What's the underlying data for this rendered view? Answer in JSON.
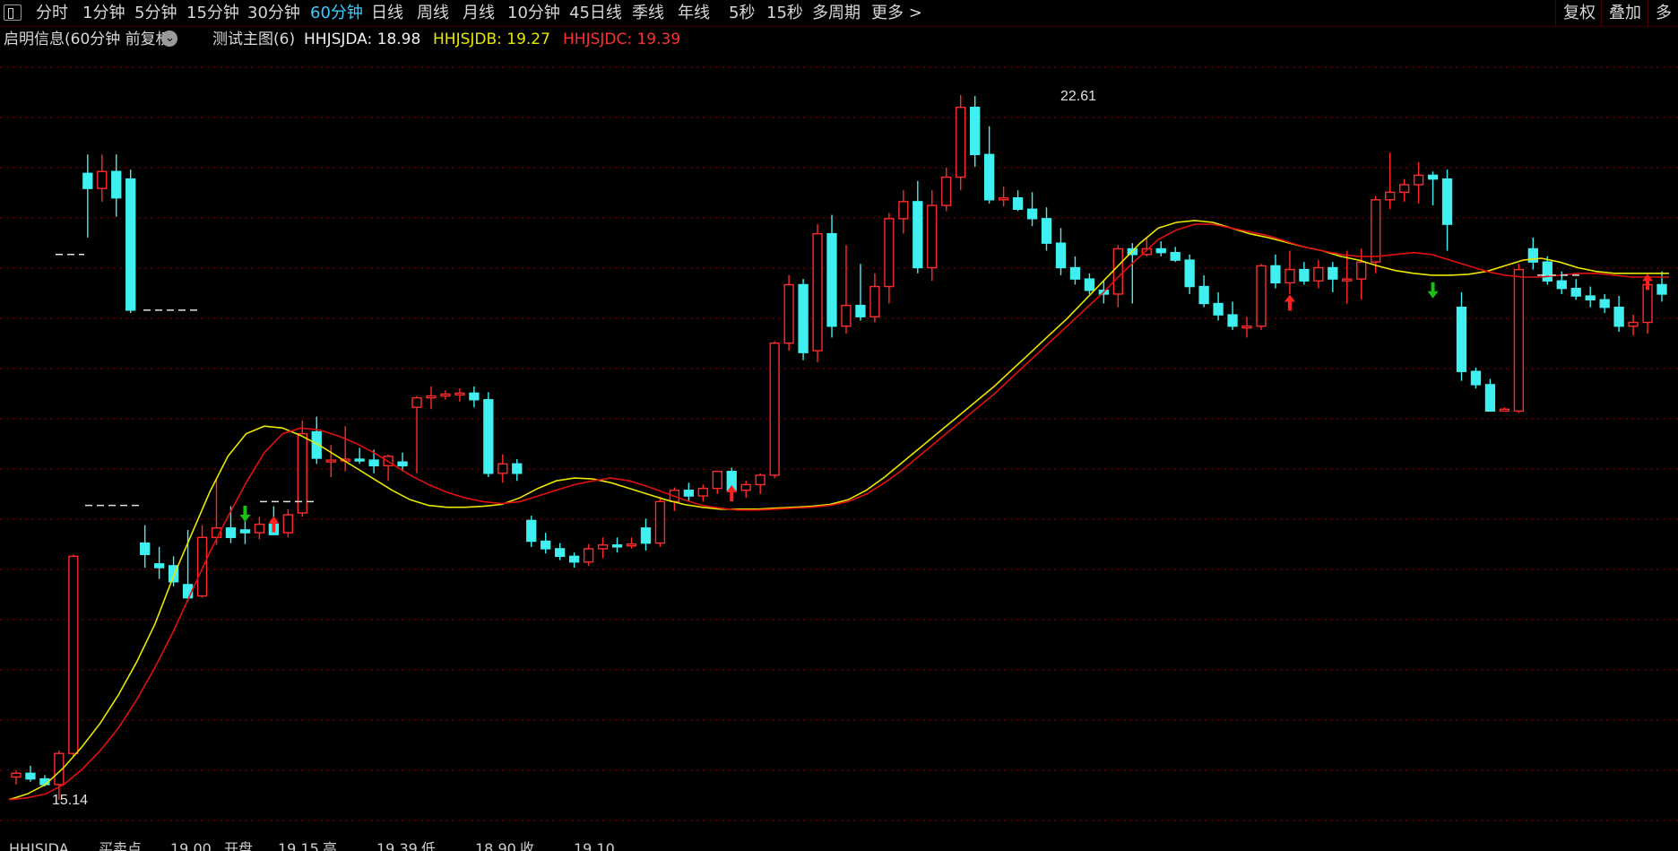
{
  "toolbar": {
    "periods": [
      "分时",
      "1分钟",
      "5分钟",
      "15分钟",
      "30分钟",
      "60分钟",
      "日线",
      "周线",
      "月线",
      "10分钟",
      "45日线",
      "季线",
      "年线",
      "5秒",
      "15秒",
      "多周期",
      "更多 >"
    ],
    "active_index": 5,
    "right": [
      "复权",
      "叠加",
      "多"
    ]
  },
  "info": {
    "title": "启明信息(60分钟 前复权)",
    "indicator": "测试主图(6)",
    "a_label": "HHJSJDA: 18.98",
    "b_label": "HHJSJDB: 19.27",
    "c_label": "HHJSJDC: 19.39"
  },
  "colors": {
    "up": "#ff2b2b",
    "down": "#40f0f0",
    "ma_yellow": "#e8e800",
    "ma_red": "#e01010",
    "grid": "#6a0000",
    "buy_arrow": "#ff2020",
    "sell_arrow": "#18c018"
  },
  "chart": {
    "high_label": "22.61",
    "low_label": "15.14"
  },
  "bottom": {
    "items": [
      "HHJSJDA",
      "买卖点",
      "19.00",
      "开盘",
      "19.15",
      "高",
      "19.39",
      "低",
      "18.90",
      "收",
      "19.10"
    ]
  },
  "chart_data": {
    "type": "candlestick",
    "ylim": [
      14.9,
      23.0
    ],
    "high": 22.61,
    "low": 15.14,
    "candles": [
      [
        15.38,
        15.45,
        15.3,
        15.42
      ],
      [
        15.42,
        15.5,
        15.33,
        15.36
      ],
      [
        15.36,
        15.4,
        15.28,
        15.3
      ],
      [
        15.3,
        15.66,
        15.14,
        15.63
      ],
      [
        15.63,
        17.74,
        15.6,
        17.72
      ],
      [
        21.78,
        21.98,
        21.1,
        21.62
      ],
      [
        21.62,
        21.98,
        21.48,
        21.8
      ],
      [
        21.8,
        21.98,
        21.32,
        21.52
      ],
      [
        21.72,
        21.82,
        20.3,
        20.33
      ],
      [
        17.86,
        18.05,
        17.6,
        17.74
      ],
      [
        17.64,
        17.82,
        17.48,
        17.6
      ],
      [
        17.62,
        17.72,
        17.4,
        17.45
      ],
      [
        17.42,
        18.0,
        17.24,
        17.28
      ],
      [
        17.3,
        18.05,
        17.28,
        17.92
      ],
      [
        17.92,
        18.55,
        17.84,
        18.02
      ],
      [
        18.02,
        18.25,
        17.86,
        17.92
      ],
      [
        18.0,
        18.15,
        17.85,
        17.97
      ],
      [
        17.97,
        18.14,
        17.9,
        18.06
      ],
      [
        18.06,
        18.25,
        17.95,
        17.95
      ],
      [
        17.97,
        18.22,
        17.92,
        18.16
      ],
      [
        18.18,
        19.16,
        18.14,
        19.02
      ],
      [
        19.04,
        19.2,
        18.7,
        18.76
      ],
      [
        18.74,
        18.9,
        18.56,
        18.74
      ],
      [
        18.74,
        19.1,
        18.62,
        18.75
      ],
      [
        18.75,
        18.87,
        18.7,
        18.74
      ],
      [
        18.74,
        18.85,
        18.6,
        18.68
      ],
      [
        18.68,
        18.8,
        18.52,
        18.78
      ],
      [
        18.72,
        18.82,
        18.62,
        18.68
      ],
      [
        19.3,
        19.42,
        18.6,
        19.4
      ],
      [
        19.4,
        19.52,
        19.28,
        19.42
      ],
      [
        19.42,
        19.48,
        19.38,
        19.44
      ],
      [
        19.44,
        19.5,
        19.36,
        19.45
      ],
      [
        19.45,
        19.52,
        19.3,
        19.38
      ],
      [
        19.38,
        19.46,
        18.56,
        18.6
      ],
      [
        18.6,
        18.8,
        18.5,
        18.7
      ],
      [
        18.7,
        18.75,
        18.52,
        18.6
      ],
      [
        18.1,
        18.15,
        17.82,
        17.88
      ],
      [
        17.88,
        17.97,
        17.75,
        17.8
      ],
      [
        17.8,
        17.86,
        17.68,
        17.72
      ],
      [
        17.72,
        17.76,
        17.6,
        17.66
      ],
      [
        17.66,
        17.85,
        17.62,
        17.8
      ],
      [
        17.8,
        17.92,
        17.7,
        17.84
      ],
      [
        17.84,
        17.92,
        17.76,
        17.82
      ],
      [
        17.84,
        17.92,
        17.8,
        17.85
      ],
      [
        18.02,
        18.12,
        17.78,
        17.86
      ],
      [
        17.86,
        18.35,
        17.82,
        18.3
      ],
      [
        18.3,
        18.45,
        18.2,
        18.42
      ],
      [
        18.42,
        18.5,
        18.3,
        18.36
      ],
      [
        18.36,
        18.48,
        18.3,
        18.44
      ],
      [
        18.44,
        18.62,
        18.38,
        18.62
      ],
      [
        18.62,
        18.66,
        18.4,
        18.42
      ],
      [
        18.42,
        18.52,
        18.34,
        18.48
      ],
      [
        18.48,
        18.6,
        18.38,
        18.58
      ],
      [
        18.58,
        20.0,
        18.55,
        19.98
      ],
      [
        19.98,
        20.7,
        19.9,
        20.6
      ],
      [
        20.6,
        20.66,
        19.8,
        19.88
      ],
      [
        19.9,
        21.24,
        19.78,
        21.14
      ],
      [
        21.14,
        21.34,
        20.04,
        20.16
      ],
      [
        20.16,
        21.02,
        20.08,
        20.38
      ],
      [
        20.38,
        20.82,
        20.22,
        20.26
      ],
      [
        20.26,
        20.72,
        20.2,
        20.58
      ],
      [
        20.58,
        21.36,
        20.4,
        21.3
      ],
      [
        21.3,
        21.6,
        21.14,
        21.48
      ],
      [
        21.48,
        21.7,
        20.72,
        20.78
      ],
      [
        20.78,
        21.6,
        20.64,
        21.44
      ],
      [
        21.44,
        21.84,
        21.38,
        21.74
      ],
      [
        21.74,
        22.61,
        21.6,
        22.48
      ],
      [
        22.48,
        22.6,
        21.85,
        21.98
      ],
      [
        21.98,
        22.28,
        21.46,
        21.5
      ],
      [
        21.5,
        21.64,
        21.43,
        21.52
      ],
      [
        21.52,
        21.6,
        21.38,
        21.4
      ],
      [
        21.4,
        21.58,
        21.22,
        21.3
      ],
      [
        21.3,
        21.42,
        20.96,
        21.04
      ],
      [
        21.04,
        21.2,
        20.7,
        20.78
      ],
      [
        20.78,
        20.9,
        20.6,
        20.66
      ],
      [
        20.66,
        20.72,
        20.5,
        20.54
      ],
      [
        20.54,
        20.64,
        20.4,
        20.5
      ],
      [
        20.5,
        21.02,
        20.36,
        20.98
      ],
      [
        20.98,
        21.04,
        20.4,
        20.92
      ],
      [
        20.92,
        21.1,
        20.9,
        20.98
      ],
      [
        20.98,
        21.06,
        20.9,
        20.94
      ],
      [
        20.94,
        21.0,
        20.84,
        20.86
      ],
      [
        20.86,
        20.92,
        20.5,
        20.58
      ],
      [
        20.58,
        20.7,
        20.36,
        20.4
      ],
      [
        20.4,
        20.52,
        20.22,
        20.28
      ],
      [
        20.28,
        20.42,
        20.12,
        20.16
      ],
      [
        20.16,
        20.26,
        20.04,
        20.16
      ],
      [
        20.16,
        20.82,
        20.12,
        20.8
      ],
      [
        20.8,
        20.92,
        20.56,
        20.62
      ],
      [
        20.62,
        20.96,
        20.5,
        20.76
      ],
      [
        20.76,
        20.84,
        20.6,
        20.64
      ],
      [
        20.64,
        20.86,
        20.56,
        20.78
      ],
      [
        20.78,
        20.84,
        20.52,
        20.66
      ],
      [
        20.66,
        20.96,
        20.4,
        20.66
      ],
      [
        20.66,
        20.98,
        20.44,
        20.84
      ],
      [
        20.84,
        21.54,
        20.72,
        21.5
      ],
      [
        21.5,
        22.0,
        21.4,
        21.58
      ],
      [
        21.58,
        21.72,
        21.48,
        21.66
      ],
      [
        21.66,
        21.9,
        21.46,
        21.76
      ],
      [
        21.76,
        21.8,
        21.44,
        21.72
      ],
      [
        21.72,
        21.82,
        20.96,
        21.24
      ],
      [
        20.36,
        20.52,
        19.58,
        19.68
      ],
      [
        19.68,
        19.72,
        19.5,
        19.54
      ],
      [
        19.54,
        19.6,
        19.26,
        19.26
      ],
      [
        19.26,
        19.3,
        19.26,
        19.28
      ],
      [
        19.26,
        20.82,
        19.24,
        20.76
      ],
      [
        20.98,
        21.1,
        20.76,
        20.84
      ],
      [
        20.84,
        20.9,
        20.6,
        20.64
      ],
      [
        20.64,
        20.74,
        20.5,
        20.56
      ],
      [
        20.56,
        20.66,
        20.44,
        20.48
      ],
      [
        20.48,
        20.58,
        20.36,
        20.44
      ],
      [
        20.44,
        20.5,
        20.3,
        20.36
      ],
      [
        20.36,
        20.48,
        20.1,
        20.16
      ],
      [
        20.16,
        20.28,
        20.06,
        20.2
      ],
      [
        20.2,
        20.66,
        20.08,
        20.6
      ],
      [
        20.6,
        20.74,
        20.42,
        20.5
      ]
    ],
    "ma_yellow": [
      15.14,
      15.2,
      15.3,
      15.48,
      15.7,
      15.95,
      16.25,
      16.6,
      17.0,
      17.5,
      17.95,
      18.4,
      18.78,
      19.02,
      19.1,
      19.08,
      19.0,
      18.9,
      18.78,
      18.66,
      18.54,
      18.42,
      18.32,
      18.26,
      18.24,
      18.24,
      18.25,
      18.27,
      18.34,
      18.44,
      18.52,
      18.55,
      18.54,
      18.5,
      18.44,
      18.38,
      18.32,
      18.27,
      18.24,
      18.22,
      18.22,
      18.22,
      18.23,
      18.24,
      18.25,
      18.27,
      18.32,
      18.42,
      18.56,
      18.72,
      18.88,
      19.04,
      19.2,
      19.36,
      19.52,
      19.7,
      19.88,
      20.06,
      20.24,
      20.44,
      20.64,
      20.84,
      21.04,
      21.2,
      21.26,
      21.28,
      21.26,
      21.2,
      21.14,
      21.1,
      21.05,
      21.0,
      20.96,
      20.9,
      20.86,
      20.8,
      20.75,
      20.72,
      20.7,
      20.7,
      20.71,
      20.74,
      20.8,
      20.86,
      20.88,
      20.84,
      20.78,
      20.74,
      20.72,
      20.72,
      20.72,
      20.72
    ],
    "ma_red": [
      15.14,
      15.16,
      15.2,
      15.3,
      15.46,
      15.66,
      15.9,
      16.2,
      16.54,
      16.92,
      17.34,
      17.76,
      18.14,
      18.5,
      18.82,
      19.02,
      19.08,
      19.06,
      19.0,
      18.92,
      18.82,
      18.7,
      18.58,
      18.48,
      18.4,
      18.34,
      18.3,
      18.28,
      18.3,
      18.36,
      18.42,
      18.48,
      18.52,
      18.55,
      18.52,
      18.46,
      18.39,
      18.32,
      18.26,
      18.23,
      18.21,
      18.21,
      18.22,
      18.23,
      18.24,
      18.26,
      18.3,
      18.38,
      18.5,
      18.64,
      18.8,
      18.96,
      19.12,
      19.28,
      19.44,
      19.62,
      19.8,
      19.98,
      20.16,
      20.34,
      20.52,
      20.72,
      20.9,
      21.08,
      21.18,
      21.24,
      21.24,
      21.2,
      21.16,
      21.12,
      21.06,
      21.0,
      20.96,
      20.92,
      20.9,
      20.9,
      20.92,
      20.94,
      20.92,
      20.86,
      20.8,
      20.74,
      20.7,
      20.68,
      20.68,
      20.7,
      20.72,
      20.72,
      20.7,
      20.68,
      20.68,
      20.68
    ]
  }
}
